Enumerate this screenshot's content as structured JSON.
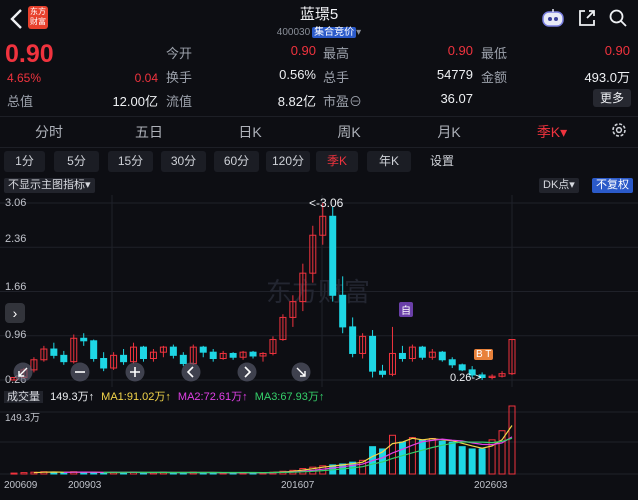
{
  "header": {
    "logo_line1": "东方",
    "logo_line2": "财富",
    "stock_name": "蓝璟5",
    "stock_code": "400030",
    "stock_tag": "集合竞价",
    "tag_arrow": "▾"
  },
  "quote": {
    "price": "0.90",
    "change_pct": "4.65%",
    "change_amt": "0.04",
    "market_value_label": "总值",
    "market_value": "12.00亿",
    "open_label": "今开",
    "open": "0.90",
    "high_label": "最高",
    "high": "0.90",
    "low_label": "最低",
    "low": "0.90",
    "turnover_label": "换手",
    "turnover": "0.56%",
    "volume_label": "总手",
    "volume": "54779",
    "amount_label": "金额",
    "amount": "493.0万",
    "float_label": "流值",
    "float_value": "8.82亿",
    "pe_label": "市盈",
    "pe_icon": "⊖",
    "pe": "36.07",
    "more_label": "更多"
  },
  "period_tabs": [
    "分时",
    "五日",
    "日K",
    "周K",
    "月K",
    "季K▾"
  ],
  "active_period": "季K▾",
  "sub_tabs": [
    "1分",
    "5分",
    "15分",
    "30分",
    "60分",
    "120分",
    "季K",
    "年K",
    "设置"
  ],
  "active_sub": "季K",
  "controls": {
    "indicator": "不显示主图指标▾",
    "dk": "DK点▾",
    "adjust": "不复权"
  },
  "chart_axis": {
    "y_ticks": [
      "3.06",
      "2.36",
      "1.66",
      "0.96",
      "0.26"
    ],
    "max_marker": "<-3.06",
    "min_marker": "0.26->",
    "bt_label": "B T",
    "self_label": "自",
    "watermark": "东方财富"
  },
  "volume": {
    "label": "成交量",
    "current": "149.3万↑",
    "ma1": "MA1:91.02万↑",
    "ma2": "MA2:72.61万↑",
    "ma3": "MA3:67.93万↑",
    "max": "149.3万"
  },
  "x_ticks": [
    "200609",
    "200903",
    "201607",
    "202603"
  ],
  "colors": {
    "up": "#f0333e",
    "down": "#1ed6e4",
    "ma1": "#f3d54a",
    "ma2": "#e040e6",
    "ma3": "#35d06a",
    "accent_blue": "#2b5ac9"
  },
  "chart_data": {
    "type": "candlestick",
    "ylim": [
      0.26,
      3.06
    ],
    "candles": [
      [
        0.26,
        0.3,
        0.26,
        0.3
      ],
      [
        0.3,
        0.45,
        0.28,
        0.42
      ],
      [
        0.42,
        0.62,
        0.38,
        0.58
      ],
      [
        0.58,
        0.8,
        0.55,
        0.75
      ],
      [
        0.75,
        0.85,
        0.6,
        0.65
      ],
      [
        0.65,
        0.72,
        0.5,
        0.55
      ],
      [
        0.55,
        0.98,
        0.52,
        0.92
      ],
      [
        0.92,
        1.0,
        0.8,
        0.88
      ],
      [
        0.88,
        0.9,
        0.55,
        0.6
      ],
      [
        0.6,
        0.7,
        0.4,
        0.45
      ],
      [
        0.45,
        0.7,
        0.42,
        0.65
      ],
      [
        0.65,
        0.75,
        0.5,
        0.55
      ],
      [
        0.55,
        0.85,
        0.52,
        0.78
      ],
      [
        0.78,
        0.8,
        0.55,
        0.6
      ],
      [
        0.6,
        0.75,
        0.55,
        0.7
      ],
      [
        0.7,
        0.8,
        0.62,
        0.78
      ],
      [
        0.78,
        0.82,
        0.6,
        0.65
      ],
      [
        0.65,
        0.7,
        0.48,
        0.52
      ],
      [
        0.52,
        0.82,
        0.5,
        0.78
      ],
      [
        0.78,
        0.8,
        0.62,
        0.7
      ],
      [
        0.7,
        0.75,
        0.55,
        0.6
      ],
      [
        0.6,
        0.72,
        0.58,
        0.68
      ],
      [
        0.68,
        0.7,
        0.58,
        0.62
      ],
      [
        0.62,
        0.72,
        0.58,
        0.7
      ],
      [
        0.7,
        0.72,
        0.6,
        0.64
      ],
      [
        0.64,
        0.7,
        0.55,
        0.68
      ],
      [
        0.68,
        0.95,
        0.65,
        0.9
      ],
      [
        0.9,
        1.3,
        0.88,
        1.25
      ],
      [
        1.25,
        1.6,
        1.1,
        1.5
      ],
      [
        1.5,
        2.1,
        1.35,
        1.95
      ],
      [
        1.95,
        2.7,
        1.8,
        2.55
      ],
      [
        2.55,
        3.06,
        2.4,
        2.85
      ],
      [
        2.85,
        3.0,
        1.5,
        1.6
      ],
      [
        1.6,
        1.9,
        1.0,
        1.1
      ],
      [
        1.1,
        1.25,
        0.62,
        0.68
      ],
      [
        0.68,
        1.0,
        0.6,
        0.95
      ],
      [
        0.95,
        1.05,
        0.3,
        0.4
      ],
      [
        0.4,
        0.5,
        0.3,
        0.35
      ],
      [
        0.35,
        1.1,
        0.32,
        0.68
      ],
      [
        0.68,
        0.8,
        0.55,
        0.6
      ],
      [
        0.6,
        0.82,
        0.55,
        0.78
      ],
      [
        0.78,
        0.8,
        0.58,
        0.62
      ],
      [
        0.62,
        0.75,
        0.58,
        0.7
      ],
      [
        0.7,
        0.72,
        0.55,
        0.58
      ],
      [
        0.58,
        0.62,
        0.45,
        0.5
      ],
      [
        0.5,
        0.52,
        0.4,
        0.42
      ],
      [
        0.42,
        0.48,
        0.3,
        0.34
      ],
      [
        0.34,
        0.38,
        0.26,
        0.3
      ],
      [
        0.3,
        0.35,
        0.27,
        0.32
      ],
      [
        0.32,
        0.4,
        0.3,
        0.36
      ],
      [
        0.36,
        0.9,
        0.34,
        0.9
      ]
    ],
    "volumes": [
      2,
      3,
      4,
      5,
      4,
      3,
      5,
      4,
      3,
      3,
      4,
      3,
      4,
      3,
      3,
      4,
      3,
      3,
      4,
      3,
      3,
      3,
      3,
      3,
      3,
      3,
      4,
      6,
      8,
      12,
      15,
      18,
      20,
      22,
      26,
      30,
      60,
      55,
      85,
      70,
      80,
      75,
      78,
      72,
      70,
      60,
      55,
      55,
      75,
      95,
      149.3
    ]
  }
}
